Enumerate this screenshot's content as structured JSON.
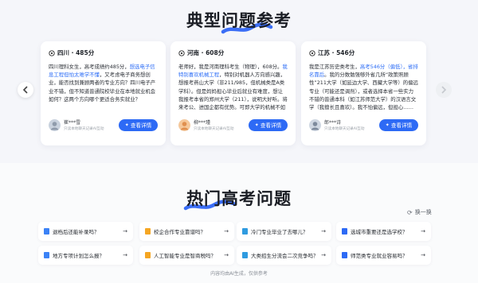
{
  "section1": {
    "title": "典型问题参考"
  },
  "cards": [
    {
      "location": "四川 · 485分",
      "body_before": "四川理科女生，高考成绩约485分，",
      "body_highlight": "想选电子信息工程但怕太难学不懂",
      "body_after": "，又考虑电子商务想创业，能否找到兼顾两者的专业方向？四川电子产业不错，但不知道普通院校毕业在本地就业机会如何？这两个方向哪个更适合务实就业？",
      "user_name": "崔***雪",
      "user_note": "只读本地聊天记录AI互动",
      "button": "查看详情"
    },
    {
      "location": "河南 · 608分",
      "body_before": "老师好，我是河南理科考生（物理），608分。",
      "body_highlight": "我特别喜欢机械工程",
      "body_after": "，特别对机器人方向感兴趣，想报考燕山大学（非211/985，但机械类是A类学科）。但是妈妈担心毕业后就业有难度，想让我报考本省的郑州大学（211），说明大好听。将来考公、进国企都有优势。可即大学的机械不如燕山，我实在没问题学……",
      "user_name": "柳***瑾",
      "user_note": "只读本地聊天记录AI互动",
      "button": "查看详情"
    },
    {
      "location": "江苏 · 546分",
      "body_before": "我是江苏历史类考生，",
      "body_highlight": "高考546分（偏低），省排名靠后",
      "body_after": "。我的分数勉强够外省几所“政策照顾性”211大学（如延边大学、西藏大学等）的偏远专业（可能还是调剂），或者选择本省一些实力不错的普通本科（如江苏师范大学）的汉语言文学（我擅长且喜欢）。我不怕偏远，但担心……",
      "user_name": "郎***诗",
      "user_note": "只读本地聊天记录AI互动",
      "button": "查看详情"
    }
  ],
  "section2": {
    "title": "热门高考问题",
    "refresh": "换一换"
  },
  "questions": [
    {
      "text": "退档后还能补录吗？",
      "color": "#3b82f6"
    },
    {
      "text": "校企合作专业靠谱吗？",
      "color": "#f5a623"
    },
    {
      "text": "冷门专业毕业了去哪儿？",
      "color": "#2f9be0"
    },
    {
      "text": "选城市重要还是选学校？",
      "color": "#2d6af5"
    },
    {
      "text": "地方专项计划怎么报？",
      "color": "#3b82f6"
    },
    {
      "text": "人工智能专业是智商税吗？",
      "color": "#f5a623"
    },
    {
      "text": "大类招生分流会二次竞争吗？",
      "color": "#2f9be0"
    },
    {
      "text": "师范类专业就业容易吗？",
      "color": "#2d6af5"
    }
  ],
  "footer": "内容均由AI生成，仅供参考",
  "colors": {
    "accent": "#2d6af5",
    "squiggle": "#3b6ef6"
  }
}
